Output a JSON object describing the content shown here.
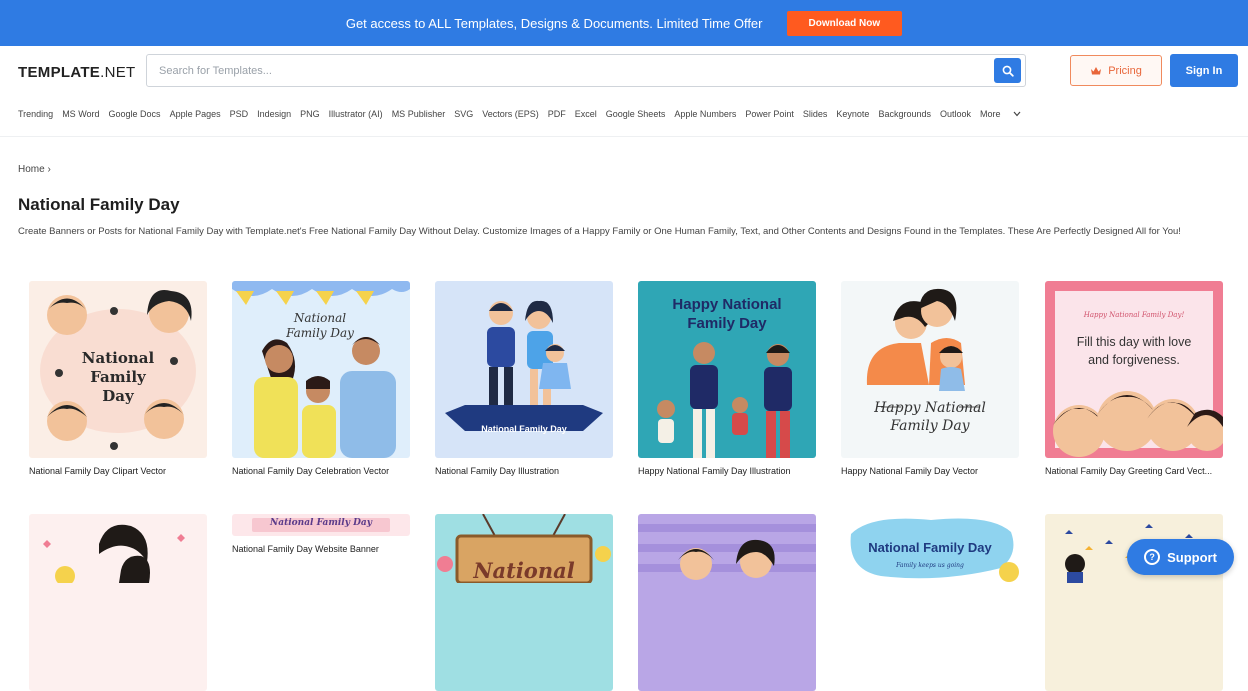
{
  "promo": {
    "text": "Get access to ALL Templates, Designs & Documents. Limited Time Offer",
    "button": "Download Now"
  },
  "header": {
    "logo_bold": "TEMPLATE",
    "logo_light": ".NET",
    "search_placeholder": "Search for Templates...",
    "pricing_label": "Pricing",
    "signin_label": "Sign In"
  },
  "categories": [
    "Trending",
    "MS Word",
    "Google Docs",
    "Apple Pages",
    "PSD",
    "Indesign",
    "PNG",
    "Illustrator (AI)",
    "MS Publisher",
    "SVG",
    "Vectors (EPS)",
    "PDF",
    "Excel",
    "Google Sheets",
    "Apple Numbers",
    "Power Point",
    "Slides",
    "Keynote",
    "Backgrounds",
    "Outlook"
  ],
  "more_label": "More",
  "breadcrumb": "Home ›",
  "page": {
    "title": "National Family Day",
    "description": "Create Banners or Posts for National Family Day with Template.net's Free National Family Day Without Delay. Customize Images of a Happy Family or One Human Family, Text, and Other Contents and Designs Found in the Templates. These Are Perfectly Designed All for You!"
  },
  "cards": [
    {
      "title": "National Family Day Clipart Vector",
      "thumb_text": "National Family Day",
      "bg": "#fbeee6"
    },
    {
      "title": "National Family Day Celebration Vector",
      "thumb_text": "National Family Day",
      "bg": "#dfeefb"
    },
    {
      "title": "National Family Day Illustration",
      "thumb_text": "National Family Day",
      "bg": "#d6e4f8"
    },
    {
      "title": "Happy National Family Day Illustration",
      "thumb_text": "Happy National Family Day",
      "bg": "#2fa6b5"
    },
    {
      "title": "Happy National Family Day Vector",
      "thumb_text": "Happy National Family Day",
      "bg": "#f3f7f8"
    },
    {
      "title": "National Family Day Greeting Card Vect...",
      "thumb_text": "Fill this day with love and forgiveness.",
      "thumb_small": "Happy National Family Day!",
      "bg": "#f07d93"
    },
    {
      "title": "",
      "bg": "#fdf0ef"
    },
    {
      "title": "National Family Day Website Banner",
      "thumb_text": "National Family Day",
      "bg": "#fde7ea"
    },
    {
      "title": "",
      "thumb_text": "National",
      "bg": "#9fdfe3"
    },
    {
      "title": "",
      "bg": "#b9a6e6"
    },
    {
      "title": "",
      "thumb_text": "National Family Day",
      "thumb_small": "Family keeps us going",
      "bg": "#ffffff"
    },
    {
      "title": "",
      "bg": "#f7f0dc"
    }
  ],
  "support_label": "Support",
  "colors": {
    "accent": "#2f7be3",
    "promo_button": "#ff5a1f",
    "pricing": "#e8663a"
  }
}
